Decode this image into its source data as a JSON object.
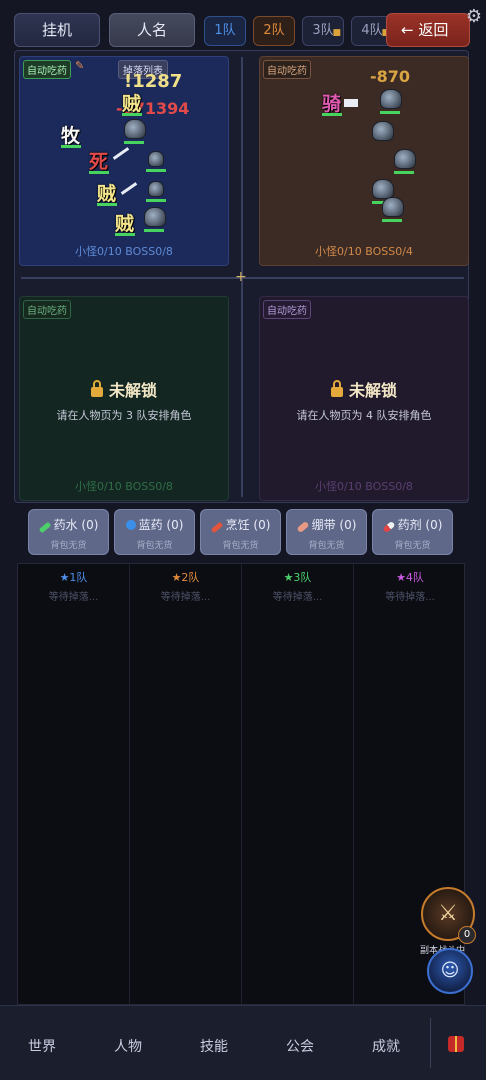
{
  "topbar": {
    "idle_label": "挂机",
    "name_label": "人名",
    "teams": [
      {
        "label": "1队",
        "locked": false
      },
      {
        "label": "2队",
        "locked": false
      },
      {
        "label": "3队",
        "locked": true
      },
      {
        "label": "4队",
        "locked": true
      }
    ],
    "back_label": "← 返回",
    "settings_icon": "gear-icon"
  },
  "battle": {
    "q1": {
      "auto_label": "自动吃药",
      "drop_label": "掉落列表",
      "damage_top": "!1287",
      "damage_red": "-871394",
      "chars": [
        "贼",
        "牧",
        "死",
        "贼",
        "贼"
      ],
      "stats": "小怪0/10  BOSS0/8"
    },
    "q2": {
      "auto_label": "自动吃药",
      "damage_top": "-870",
      "chars": [
        "骑"
      ],
      "stats": "小怪0/10  BOSS0/4"
    },
    "q3": {
      "auto_label": "自动吃药",
      "locked_title": "未解锁",
      "locked_sub": "请在人物页为 3 队安排角色",
      "stats": "小怪0/10  BOSS0/8"
    },
    "q4": {
      "auto_label": "自动吃药",
      "locked_title": "未解锁",
      "locked_sub": "请在人物页为 4 队安排角色",
      "stats": "小怪0/10  BOSS0/8"
    }
  },
  "items": [
    {
      "name": "药水 (0)",
      "sub": "背包无货",
      "icon": "potion-icon",
      "color": "#4ccf6a"
    },
    {
      "name": "蓝药 (0)",
      "sub": "背包无货",
      "icon": "mana-icon",
      "color": "#3c8fe8"
    },
    {
      "name": "烹饪 (0)",
      "sub": "背包无货",
      "icon": "cooking-icon",
      "color": "#e0553c"
    },
    {
      "name": "绷带 (0)",
      "sub": "背包无货",
      "icon": "bandage-icon",
      "color": "#e89a84"
    },
    {
      "name": "药剂 (0)",
      "sub": "背包无货",
      "icon": "pill-icon",
      "color": "#e04444"
    }
  ],
  "loot": [
    {
      "label": "★1队",
      "wait": "等待掉落...",
      "color": "#4f8fe8"
    },
    {
      "label": "★2队",
      "wait": "等待掉落...",
      "color": "#e08a3c"
    },
    {
      "label": "★3队",
      "wait": "等待掉落...",
      "color": "#4ccf6a"
    },
    {
      "label": "★4队",
      "wait": "等待掉落...",
      "color": "#c85ae0"
    }
  ],
  "fab": {
    "battle_count": "0",
    "battle_label": "副本战斗中"
  },
  "nav": {
    "items": [
      "世界",
      "人物",
      "技能",
      "公会",
      "成就"
    ],
    "gift_icon": "gift-icon"
  }
}
